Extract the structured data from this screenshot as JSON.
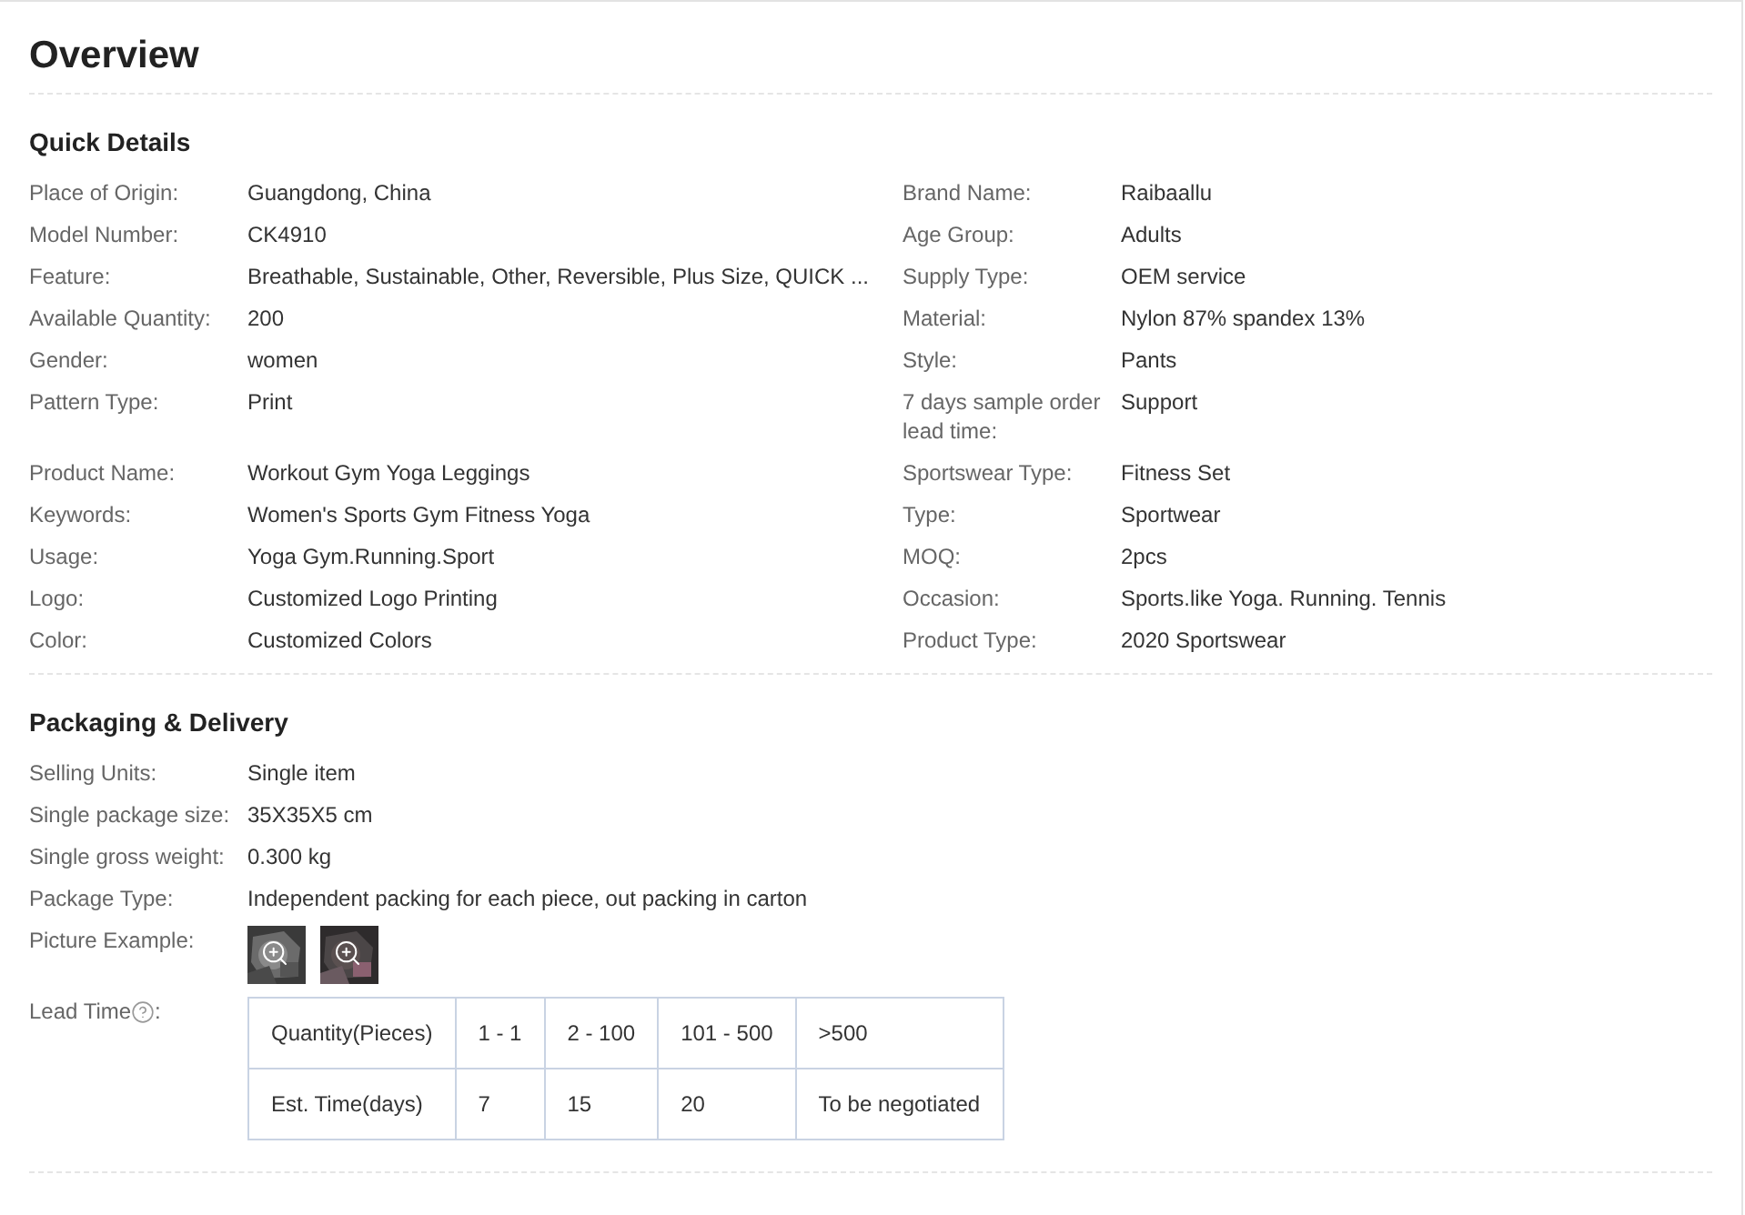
{
  "title": "Overview",
  "quick_details": {
    "title": "Quick Details",
    "rows": [
      {
        "left": {
          "label": "Place of Origin:",
          "value": "Guangdong, China"
        },
        "right": {
          "label": "Brand Name:",
          "value": "Raibaallu"
        }
      },
      {
        "left": {
          "label": "Model Number:",
          "value": "CK4910"
        },
        "right": {
          "label": "Age Group:",
          "value": "Adults"
        }
      },
      {
        "left": {
          "label": "Feature:",
          "value": "Breathable, Sustainable, Other, Reversible, Plus Size, QUICK ..."
        },
        "right": {
          "label": "Supply Type:",
          "value": "OEM service"
        }
      },
      {
        "left": {
          "label": "Available Quantity:",
          "value": "200"
        },
        "right": {
          "label": "Material:",
          "value": "Nylon 87% spandex 13%"
        }
      },
      {
        "left": {
          "label": "Gender:",
          "value": "women"
        },
        "right": {
          "label": "Style:",
          "value": "Pants"
        }
      },
      {
        "left": {
          "label": "Pattern Type:",
          "value": "Print"
        },
        "right": {
          "label": "7 days sample order lead time:",
          "value": "Support"
        }
      },
      {
        "left": {
          "label": "Product Name:",
          "value": "Workout Gym Yoga Leggings"
        },
        "right": {
          "label": "Sportswear Type:",
          "value": "Fitness Set"
        }
      },
      {
        "left": {
          "label": "Keywords:",
          "value": "Women's Sports Gym Fitness Yoga"
        },
        "right": {
          "label": "Type:",
          "value": "Sportwear"
        }
      },
      {
        "left": {
          "label": "Usage:",
          "value": "Yoga Gym.Running.Sport"
        },
        "right": {
          "label": "MOQ:",
          "value": "2pcs"
        }
      },
      {
        "left": {
          "label": "Logo:",
          "value": "Customized Logo Printing"
        },
        "right": {
          "label": "Occasion:",
          "value": "Sports.like Yoga. Running. Tennis"
        }
      },
      {
        "left": {
          "label": "Color:",
          "value": "Customized Colors"
        },
        "right": {
          "label": "Product Type:",
          "value": "2020 Sportswear"
        }
      }
    ]
  },
  "packaging": {
    "title": "Packaging & Delivery",
    "rows": [
      {
        "kind": "text",
        "label": "Selling Units:",
        "value": "Single item"
      },
      {
        "kind": "text",
        "label": "Single package size:",
        "value": "35X35X5 cm"
      },
      {
        "kind": "text",
        "label": "Single gross weight:",
        "value": "0.300 kg"
      },
      {
        "kind": "text",
        "label": "Package Type:",
        "value": "Independent packing for each piece, out packing in carton"
      },
      {
        "kind": "pictures",
        "label": "Picture Example:"
      },
      {
        "kind": "table",
        "label": "Lead Time",
        "label_suffix": ":",
        "table": {
          "rows": [
            [
              "Quantity(Pieces)",
              "1 - 1",
              "2 - 100",
              "101 - 500",
              ">500"
            ],
            [
              "Est. Time(days)",
              "7",
              "15",
              "20",
              "To be negotiated"
            ]
          ]
        }
      }
    ]
  }
}
